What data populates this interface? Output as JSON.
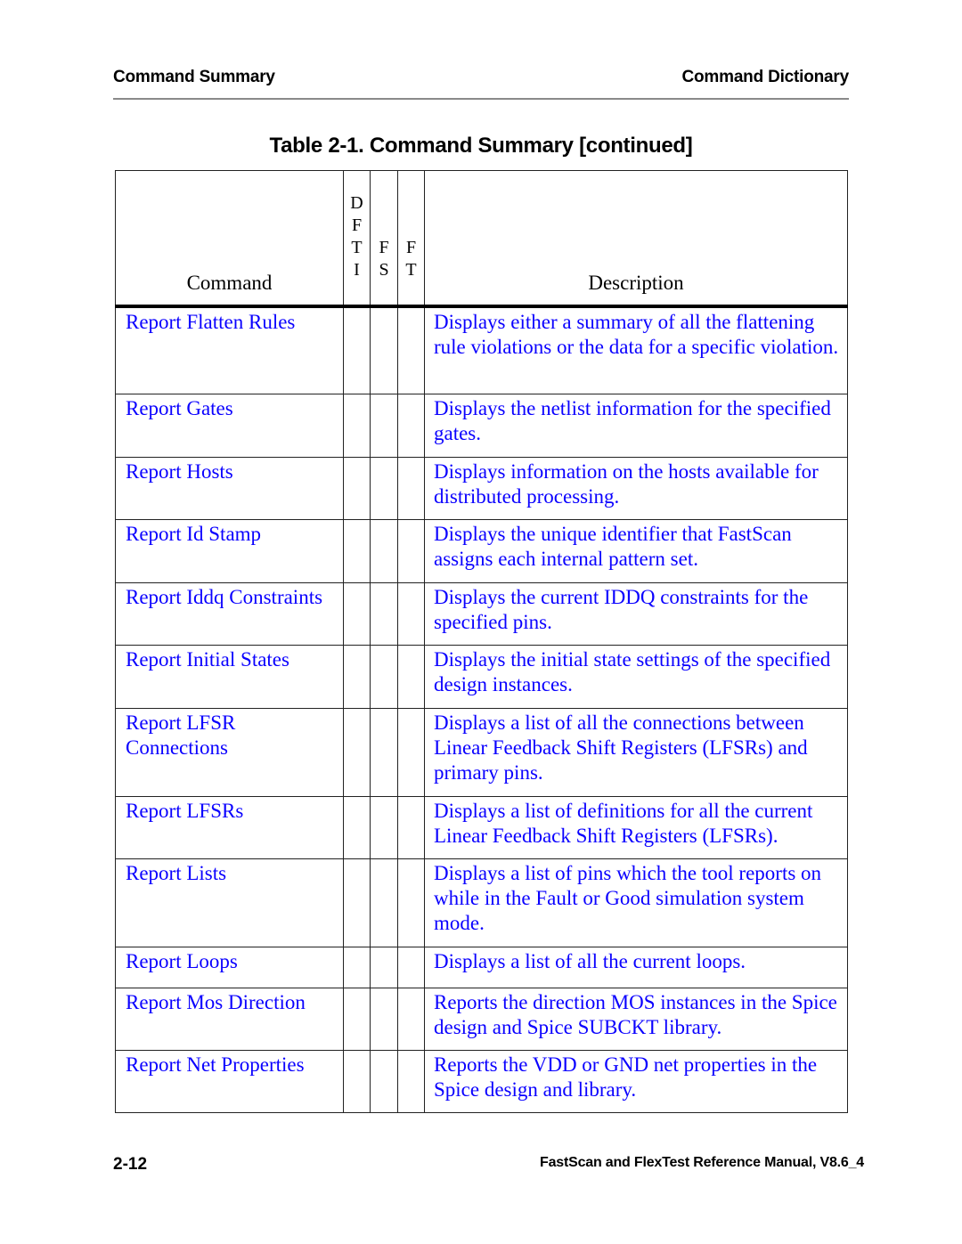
{
  "header": {
    "left": "Command Summary",
    "right": "Command Dictionary"
  },
  "table": {
    "title": "Table 2-1. Command Summary [continued]",
    "columns": {
      "command": "Command",
      "flags": [
        {
          "letters": [
            "D",
            "F",
            "T",
            "I"
          ]
        },
        {
          "letters": [
            "F",
            "S"
          ]
        },
        {
          "letters": [
            "F",
            "T"
          ]
        }
      ],
      "description": "Description"
    },
    "rows": [
      {
        "command": "Report Flatten Rules",
        "dfti": "",
        "fs": "",
        "ft": "",
        "description": "Displays either a summary of all the flattening rule violations or the data for a specific violation."
      },
      {
        "command": "Report Gates",
        "dfti": "",
        "fs": "",
        "ft": "",
        "description": "Displays the netlist information for the specified gates."
      },
      {
        "command": "Report Hosts",
        "dfti": "",
        "fs": "",
        "ft": "",
        "description": "Displays information on the hosts available for distributed processing."
      },
      {
        "command": "Report Id Stamp",
        "dfti": "",
        "fs": "",
        "ft": "",
        "description": "Displays the unique identifier that FastScan assigns each internal pattern set."
      },
      {
        "command": "Report Iddq Constraints",
        "dfti": "",
        "fs": "",
        "ft": "",
        "description": "Displays the current IDDQ constraints for the specified pins."
      },
      {
        "command": "Report Initial States",
        "dfti": "",
        "fs": "",
        "ft": "",
        "description": "Displays the initial state settings of the specified design instances."
      },
      {
        "command": "Report LFSR Connections",
        "dfti": "",
        "fs": "",
        "ft": "",
        "description": "Displays a list of all the connections between Linear Feedback Shift Registers (LFSRs) and primary pins."
      },
      {
        "command": "Report LFSRs",
        "dfti": "",
        "fs": "",
        "ft": "",
        "description": "Displays a list of definitions for all the current Linear Feedback Shift Registers (LFSRs)."
      },
      {
        "command": "Report Lists",
        "dfti": "",
        "fs": "",
        "ft": "",
        "description": "Displays a list of pins which the tool reports on while in the Fault or Good simulation system mode."
      },
      {
        "command": "Report Loops",
        "dfti": "",
        "fs": "",
        "ft": "",
        "description": "Displays a list of all the current loops."
      },
      {
        "command": "Report Mos Direction",
        "dfti": "",
        "fs": "",
        "ft": "",
        "description": "Reports the direction MOS instances in the Spice design and Spice SUBCKT library."
      },
      {
        "command": "Report Net Properties",
        "dfti": "",
        "fs": "",
        "ft": "",
        "description": "Reports the VDD or GND net properties in the Spice design and library."
      }
    ]
  },
  "footer": {
    "page_number": "2-12",
    "manual_title": "FastScan and FlexTest Reference Manual, V8.6_4"
  },
  "colors": {
    "link_text": "#0a00ff",
    "body_text": "#000000",
    "rule": "#8a8a8a"
  }
}
